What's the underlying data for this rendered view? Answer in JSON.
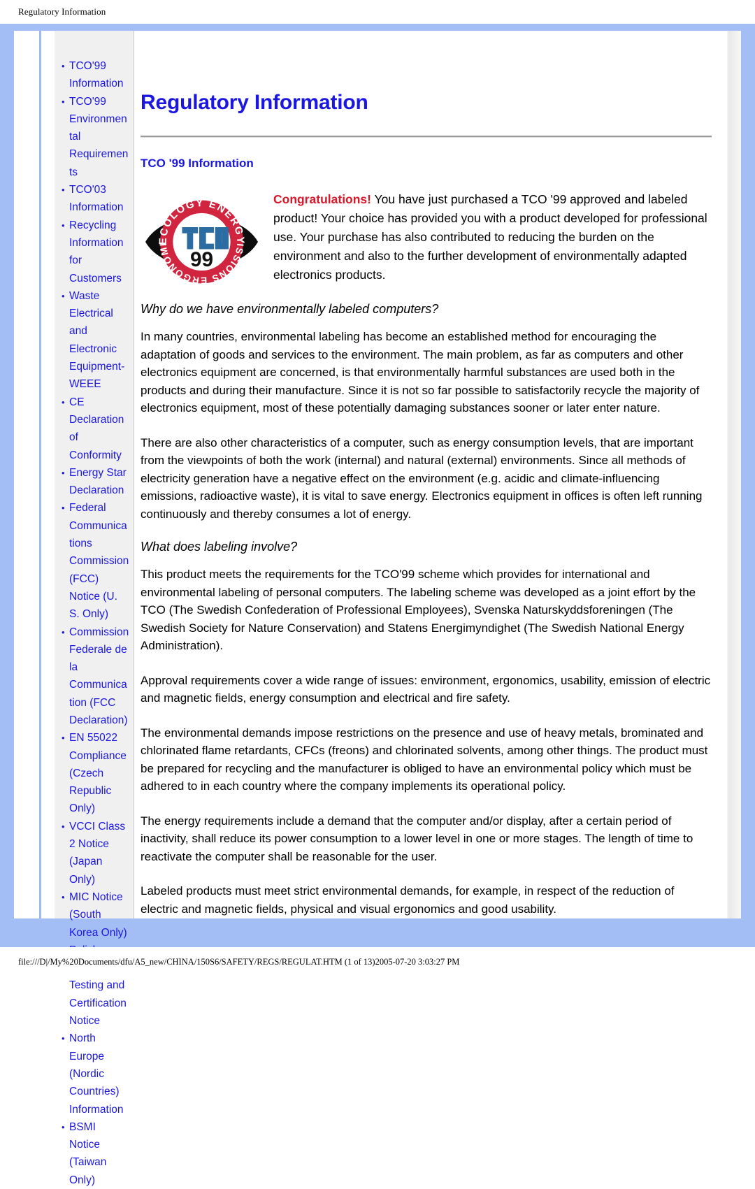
{
  "header": {
    "title": "Regulatory Information"
  },
  "sidebar": {
    "items": [
      {
        "label": "TCO'99 Information"
      },
      {
        "label": "TCO'99 Environmental Requirements"
      },
      {
        "label": "TCO'03 Information"
      },
      {
        "label": "Recycling Information for Customers"
      },
      {
        "label": "Waste Electrical and Electronic Equipment-WEEE"
      },
      {
        "label": "CE Declaration of Conformity"
      },
      {
        "label": "Energy Star Declaration"
      },
      {
        "label": "Federal Communications Commission (FCC) Notice (U. S. Only)"
      },
      {
        "label": "Commission Federale de la Communication (FCC Declaration)"
      },
      {
        "label": "EN 55022 Compliance (Czech Republic Only)"
      },
      {
        "label": "VCCI Class 2 Notice (Japan Only)"
      },
      {
        "label": "MIC Notice (South Korea Only)"
      },
      {
        "label": "Polish Center for Testing and Certification Notice"
      },
      {
        "label": "North Europe (Nordic Countries) Information"
      },
      {
        "label": "BSMI Notice (Taiwan Only)"
      }
    ]
  },
  "main": {
    "page_title": "Regulatory Information",
    "section_title": "TCO '99 Information",
    "logo": {
      "name": "tco-99-certification-logo",
      "top_text": "ECOLOGY ENERGY",
      "bottom_text": "EMISSIONS ERGONOMICS",
      "center_text": "TCO",
      "year_text": "99",
      "ring_color": "#d0243f",
      "mark_color": "#2b6ca3",
      "year_color": "#111111"
    },
    "intro": {
      "lead": "Congratulations!",
      "lead_color": "#d7182a",
      "body": " You have just purchased a TCO '99 approved and labeled product! Your choice has provided you with a product developed for professional use. Your purchase has also contributed to reducing the burden on the environment and also to the further development of environmentally adapted electronics products."
    },
    "subheads": {
      "why": "Why do we have environmentally labeled computers?",
      "what": "What does labeling involve?"
    },
    "paragraphs": {
      "p1": "In many countries, environmental labeling has become an established method for encouraging the adaptation of goods and services to the environment. The main problem, as far as computers and other electronics equipment are concerned, is that environmentally harmful substances are used both in the products and during their manufacture. Since it is not so far possible to satisfactorily recycle the majority of electronics equipment, most of these potentially damaging substances sooner or later enter nature.",
      "p2": "There are also other characteristics of a computer, such as energy consumption levels, that are important from the viewpoints of both the work (internal) and natural (external) environments. Since all methods of electricity generation have a negative effect on the environment (e.g. acidic and climate-influencing emissions, radioactive waste), it is vital to save energy. Electronics equipment in offices is often left running continuously and thereby consumes a lot of energy.",
      "p3": "This product meets the requirements for the TCO'99 scheme which provides for international and environmental labeling of personal computers. The labeling scheme was developed as a joint effort by the TCO (The Swedish Confederation of Professional Employees), Svenska Naturskyddsforeningen (The Swedish Society for Nature Conservation) and Statens Energimyndighet (The Swedish National Energy Administration).",
      "p4": "Approval requirements cover a wide range of issues: environment, ergonomics, usability, emission of electric and magnetic fields, energy consumption and electrical and fire safety.",
      "p5": "The environmental demands impose restrictions on the presence and use of heavy metals, brominated and chlorinated flame retardants, CFCs (freons) and chlorinated solvents, among other things. The product must be prepared for recycling and the manufacturer is obliged to have an environmental policy which must be adhered to in each country where the company implements its operational policy.",
      "p6": "The energy requirements include a demand that the computer and/or display, after a certain period of inactivity, shall reduce its power consumption to a lower level in one or more stages. The length of time to reactivate the computer shall be reasonable for the user.",
      "p7": "Labeled products must meet strict environmental demands, for example, in respect of the reduction of electric and magnetic fields, physical and visual ergonomics and good usability."
    }
  },
  "footer": {
    "status": "file:///D|/My%20Documents/dfu/A5_new/CHINA/150S6/SAFETY/REGS/REGULAT.HTM (1 of 13)2005-07-20 3:03:27 PM"
  },
  "colors": {
    "frame_blue": "#a3bdf5",
    "link_blue": "#1b17e0",
    "heading_blue": "#1b17e0",
    "sidebar_gray": "#f0f0f0",
    "accent_red": "#d7182a"
  }
}
